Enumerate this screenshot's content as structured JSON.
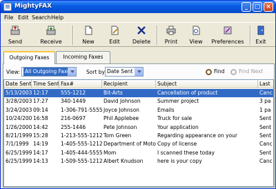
{
  "window": {
    "title": "MightyFAX"
  },
  "menu": [
    "File",
    "Edit",
    "Search",
    "Help"
  ],
  "toolbar": {
    "send": "Send",
    "receive": "Receive",
    "new": "New",
    "edit": "Edit",
    "delete": "Delete",
    "print": "Print",
    "view": "View",
    "preferences": "Preferences",
    "exit": "Exit"
  },
  "tabs": {
    "outgoing": "Outgoing Faxes",
    "incoming": "Incoming Faxes"
  },
  "filters": {
    "view_label": "View:",
    "view_value": "All Outgoing Faxes",
    "sort_label": "Sort by:",
    "sort_value": "Date Sent",
    "find": "Find",
    "find_next": "Find Next"
  },
  "table": {
    "columns": [
      "Date Sent",
      "Time Sent",
      "Fax#",
      "Recipient",
      "Subject",
      "Last"
    ],
    "rows": [
      [
        "5/13/2003",
        "12:17",
        "555-1212",
        "Bit-Arts",
        "Cancellation of product",
        "Canc"
      ],
      [
        "3/28/2003",
        "17:27",
        "340-1449",
        "David Johnson",
        "Summer project",
        "3 pa"
      ],
      [
        "3/24/2003",
        "09:14",
        "1-306-791-5555",
        "Joyce Johnson",
        "Emails",
        "1 pa"
      ],
      [
        "10/24/2000",
        "16:58",
        "216-0697",
        "Phil Applebee",
        "Truck for sale",
        "Sent"
      ],
      [
        "1/26/2000",
        "14:42",
        "255-1446",
        "Pete Johnson",
        "Your application",
        "Sent"
      ],
      [
        "8/21/1999",
        "15:28",
        "1-213-555-1212",
        "Tom Green",
        "Regarding appearance on your",
        "Sent"
      ],
      [
        "7/1/1999",
        "14:19",
        "1-405-555-1212",
        "Department of Motor Vehicles",
        "Copy of license",
        "Canc"
      ],
      [
        "6/25/1999",
        "14:17",
        "1-405-444-5555",
        "Mom",
        "I scanned these today",
        "Sent"
      ],
      [
        "6/25/1999",
        "14:13",
        "1-509-555-1212",
        "Albert Knudson",
        "here is your copy",
        "Canc"
      ]
    ]
  }
}
